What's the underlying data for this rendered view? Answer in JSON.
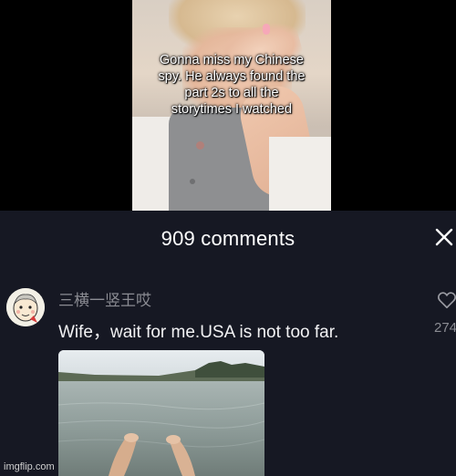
{
  "video": {
    "caption_lines": [
      "Gonna miss my Chinese",
      "spy. He always found the",
      "part 2s to all the",
      "storytimes I watched"
    ]
  },
  "comments_panel": {
    "title": "909 comments",
    "close_icon": "close-icon"
  },
  "comment": {
    "avatar_icon": "cartoon-avatar",
    "username": "三横一竖王哎",
    "text": "Wife，wait for me.USA is not too far.",
    "like_icon": "heart-outline-icon",
    "like_count": "274"
  },
  "watermark": "imgflip.com",
  "colors": {
    "panel_bg": "#161823",
    "username": "#8b8c93",
    "text": "#f2f2f4"
  }
}
